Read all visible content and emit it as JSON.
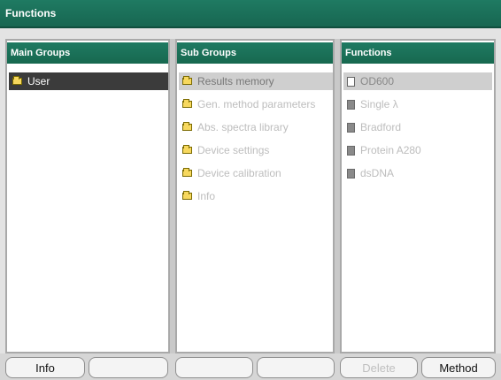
{
  "window": {
    "title": "Functions"
  },
  "panes": {
    "main_groups": {
      "header": "Main Groups",
      "items": [
        {
          "label": "User",
          "icon": "folder-icon",
          "selected": true
        }
      ]
    },
    "sub_groups": {
      "header": "Sub Groups",
      "items": [
        {
          "label": "Results memory",
          "icon": "folder-icon",
          "selected": true
        },
        {
          "label": "Gen. method parameters",
          "icon": "folder-icon"
        },
        {
          "label": "Abs. spectra library",
          "icon": "folder-icon"
        },
        {
          "label": "Device settings",
          "icon": "folder-icon"
        },
        {
          "label": "Device calibration",
          "icon": "folder-icon"
        },
        {
          "label": "Info",
          "icon": "folder-icon"
        }
      ]
    },
    "functions": {
      "header": "Functions",
      "items": [
        {
          "label": "OD600",
          "icon": "document-icon",
          "selected": true
        },
        {
          "label": "Single λ",
          "icon": "document-icon"
        },
        {
          "label": "Bradford",
          "icon": "document-icon"
        },
        {
          "label": "Protein A280",
          "icon": "document-icon"
        },
        {
          "label": "dsDNA",
          "icon": "document-icon"
        }
      ]
    }
  },
  "footer": {
    "buttons": [
      {
        "label": "Info"
      },
      {
        "label": ""
      },
      {
        "label": ""
      },
      {
        "label": ""
      },
      {
        "label": "Delete",
        "disabled": true
      },
      {
        "label": "Method"
      }
    ]
  },
  "colors": {
    "header_green": "#1f7a62",
    "selection_dark": "#3b3b3b",
    "selection_light": "#cfcfcf"
  }
}
